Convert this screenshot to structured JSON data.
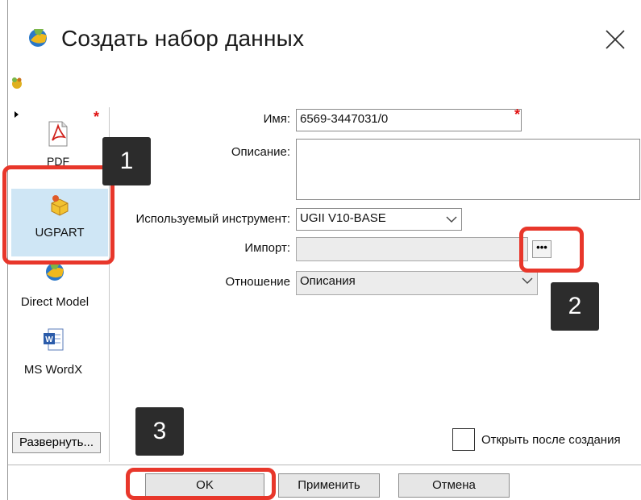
{
  "window": {
    "title": "Создать набор данных",
    "close_icon": "close-icon"
  },
  "type_list": {
    "items": [
      {
        "label": "PDF",
        "icon": "pdf-icon",
        "selected": false
      },
      {
        "label": "UGPART",
        "icon": "ugpart-icon",
        "selected": true
      },
      {
        "label": "Direct Model",
        "icon": "direct-model-icon",
        "selected": false
      },
      {
        "label": "MS WordX",
        "icon": "word-doc-icon",
        "selected": false
      }
    ],
    "required_mark": "*"
  },
  "form": {
    "name_label": "Имя:",
    "name_value": "6569-3447031/0",
    "name_required_mark": "*",
    "description_label": "Описание:",
    "description_value": "",
    "tool_label": "Используемый инструмент:",
    "tool_value": "UGII V10-BASE",
    "import_label": "Импорт:",
    "import_value": "",
    "browse_label": "•••",
    "relation_label": "Отношение",
    "relation_value": "Описания"
  },
  "expand_button": "Развернуть...",
  "open_after_create": {
    "label": "Открыть после создания",
    "checked": false
  },
  "buttons": {
    "ok": "OK",
    "apply": "Применить",
    "cancel": "Отмена"
  },
  "annotations": {
    "step1": "1",
    "step2": "2",
    "step3": "3",
    "highlight_color": "#e8372b"
  }
}
